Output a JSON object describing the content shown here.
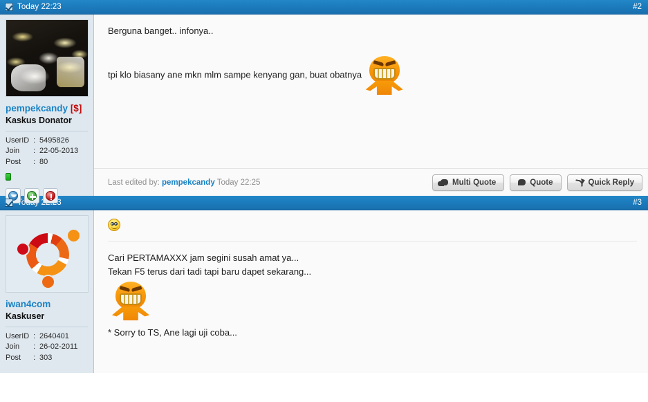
{
  "theme": {
    "header_blue_top": "#2287c8",
    "header_blue_bottom": "#1a6fae",
    "sidebar_bg": "#dfe8ef",
    "content_bg": "#fafafa",
    "link_blue": "#1a82c4",
    "donor_red": "#c20a0a",
    "online_green": "#13a713"
  },
  "posts": [
    {
      "header": {
        "date": "Today 22:23",
        "number": "#2",
        "status_icon": "checkbox-checked-icon"
      },
      "user": {
        "avatar_type": "photo-food-boxes",
        "name": "pempekcandy",
        "donor_badge": "[$]",
        "title": "Kaskus Donator",
        "meta": [
          {
            "key": "UserID",
            "sep": ":",
            "value": "5495826"
          },
          {
            "key": "Join",
            "sep": ":",
            "value": "22-05-2013"
          },
          {
            "key": "Post",
            "sep": ":",
            "value": "80"
          }
        ],
        "online_status": "online",
        "actions": [
          {
            "name": "view-profile-icon",
            "label": "View Profile"
          },
          {
            "name": "add-reputation-icon",
            "label": "Add Reputation"
          },
          {
            "name": "report-post-icon",
            "label": "Report Post"
          }
        ]
      },
      "message": {
        "line1": "Berguna banget.. infonya..",
        "line2": "tpi klo biasany ane mkn mlm sampe kenyang gan, buat obatnya",
        "emoticon": "ngakak-laughing-emoticon"
      },
      "footer": {
        "last_edited_prefix": "Last edited by:",
        "last_edited_user": "pempekcandy",
        "last_edited_time": "Today 22:25",
        "buttons": [
          {
            "label": "Multi Quote",
            "icon": "double-speech-bubble-icon"
          },
          {
            "label": "Quote",
            "icon": "speech-bubble-icon"
          },
          {
            "label": "Quick Reply",
            "icon": "reply-arrow-icon"
          }
        ]
      }
    },
    {
      "header": {
        "date": "Today 22:23",
        "number": "#3",
        "status_icon": "checkbox-checked-icon"
      },
      "user": {
        "avatar_type": "ubuntu-logo",
        "name": "iwan4com",
        "donor_badge": "",
        "title": "Kaskuser",
        "meta": [
          {
            "key": "UserID",
            "sep": ":",
            "value": "2640401"
          },
          {
            "key": "Join",
            "sep": ":",
            "value": "26-02-2011"
          },
          {
            "key": "Post",
            "sep": ":",
            "value": "303"
          }
        ],
        "online_status": "",
        "actions": []
      },
      "message": {
        "top_emoticon": "smiley-big-eyes-emoticon",
        "line1": "Cari PERTAMAXXX jam segini susah amat ya...",
        "line2": "Tekan F5 terus dari tadi tapi baru dapet sekarang...",
        "emoticon": "ngakak-laughing-emoticon",
        "line3": "* Sorry to TS, Ane lagi uji coba..."
      }
    }
  ]
}
